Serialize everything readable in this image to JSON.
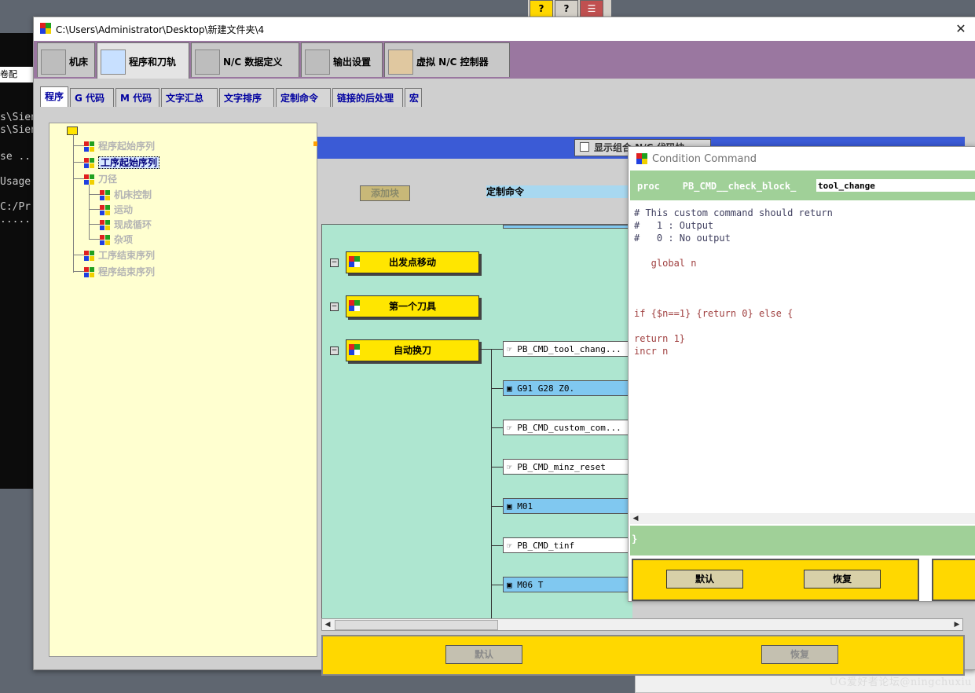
{
  "window": {
    "title": "C:\\Users\\Administrator\\Desktop\\新建文件夹\\4",
    "close_label": "✕"
  },
  "background": {
    "left_text": "卷配",
    "terminal_lines": [
      "s\\Sien",
      "s\\Sien",
      "se ...",
      " Usage",
      " C:/Pr",
      "......"
    ]
  },
  "help_toolbar": [
    "?",
    "?",
    "☰"
  ],
  "main_tabs": [
    {
      "label": "机床",
      "icon": "machine-icon",
      "active": false
    },
    {
      "label": "程序和刀轨",
      "icon": "toolpath-icon",
      "active": true
    },
    {
      "label": "N/C 数据定义",
      "icon": "nc-data-icon",
      "active": false
    },
    {
      "label": "输出设置",
      "icon": "printer-icon",
      "active": false
    },
    {
      "label": "虚拟 N/C 控制器",
      "icon": "controller-icon",
      "active": false
    }
  ],
  "sub_tabs": [
    {
      "label": "程序",
      "active": true
    },
    {
      "label": "G 代码",
      "active": false
    },
    {
      "label": "M 代码",
      "active": false
    },
    {
      "label": "文字汇总",
      "active": false
    },
    {
      "label": "文字排序",
      "active": false
    },
    {
      "label": "定制命令",
      "active": false
    },
    {
      "label": "链接的后处理",
      "active": false
    },
    {
      "label": "宏",
      "active": false
    }
  ],
  "tree": {
    "nodes": [
      {
        "label": "程序起始序列",
        "selected": false,
        "level": 1
      },
      {
        "label": "工序起始序列",
        "selected": true,
        "level": 1
      },
      {
        "label": "刀径",
        "selected": false,
        "level": 1
      },
      {
        "label": "机床控制",
        "selected": false,
        "level": 2
      },
      {
        "label": "运动",
        "selected": false,
        "level": 2
      },
      {
        "label": "现成循环",
        "selected": false,
        "level": 2
      },
      {
        "label": "杂项",
        "selected": false,
        "level": 2
      },
      {
        "label": "工序结束序列",
        "selected": false,
        "level": 1
      },
      {
        "label": "程序结束序列",
        "selected": false,
        "level": 1
      }
    ]
  },
  "sequence": {
    "checkbox_label": "显示组合 N/C 代码块",
    "add_block_label": "添加块",
    "custom_cmd_label": "定制命令",
    "markers": [
      "出发点移动",
      "第一个刀具",
      "自动换刀"
    ],
    "commands": [
      {
        "text": "PB_CMD_tool_chang...",
        "style": "white",
        "icon": "hand-icon"
      },
      {
        "text": "G91 G28 Z0.",
        "style": "blue",
        "icon": "block-icon"
      },
      {
        "text": "PB_CMD_custom_com...",
        "style": "white",
        "icon": "hand-icon"
      },
      {
        "text": "PB_CMD_minz_reset",
        "style": "white",
        "icon": "hand-icon"
      },
      {
        "text": "M01",
        "style": "blue",
        "icon": "block-icon"
      },
      {
        "text": "PB_CMD_tinf",
        "style": "white",
        "icon": "hand-icon"
      },
      {
        "text": "M06 T",
        "style": "blue",
        "icon": "block-icon"
      }
    ],
    "default_label": "默认",
    "restore_label": "恢复"
  },
  "dialog": {
    "title": "Condition Command",
    "proc_prefix": "proc    PB_CMD__check_block_",
    "proc_name": "tool_change",
    "code_lines": [
      "# This custom command should return",
      "#   1 : Output",
      "#   0 : No output",
      "",
      "   global n",
      "",
      "",
      "",
      "if {$n==1} {return 0} else {",
      "",
      "return 1}",
      "incr n"
    ],
    "closing_brace": "}",
    "default_label": "默认",
    "restore_label": "恢复"
  },
  "watermark": "UG爱好者论坛@ningchuxiu",
  "colors": {
    "tab_band": "#9a77a0",
    "blue_bar": "#3b5bd6",
    "canvas": "#aee6d0",
    "yellow": "#ffd800",
    "tree_bg": "#ffffd0",
    "dialog_green": "#a0d098"
  }
}
